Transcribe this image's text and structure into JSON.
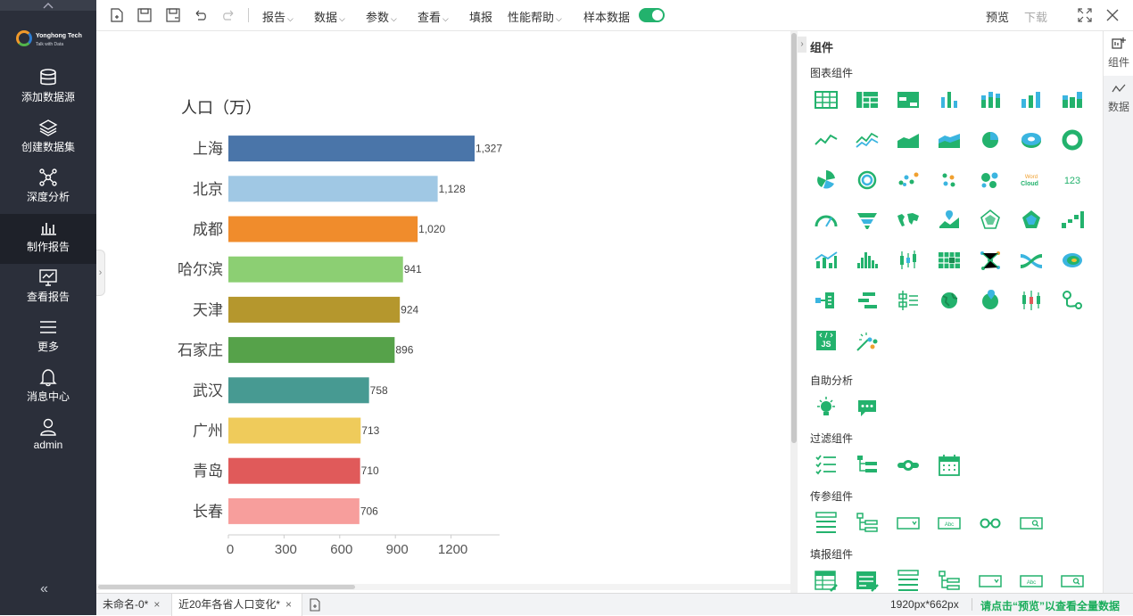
{
  "sidebar": {
    "logo": {
      "name": "Yonghong Tech",
      "tagline": "Talk with Data"
    },
    "items": [
      {
        "label": "添加数据源",
        "icon": "database-icon"
      },
      {
        "label": "创建数据集",
        "icon": "layers-icon"
      },
      {
        "label": "深度分析",
        "icon": "network-icon"
      },
      {
        "label": "制作报告",
        "icon": "bar-chart-icon",
        "active": true
      },
      {
        "label": "查看报告",
        "icon": "monitor-chart-icon"
      },
      {
        "label": "更多",
        "icon": "menu-icon"
      },
      {
        "label": "消息中心",
        "icon": "bell-icon"
      },
      {
        "label": "admin",
        "icon": "user-icon"
      }
    ],
    "collapse": "«"
  },
  "toolbar": {
    "menus": [
      "报告",
      "数据",
      "参数",
      "查看"
    ],
    "fill": "填报",
    "help": "性能帮助",
    "sample": "样本数据",
    "sample_on": true,
    "preview": "预览",
    "download": "下载"
  },
  "colors": {
    "accent": "#23b26d",
    "sidebar_bg": "#2b2f3a",
    "hint": "#1aad5b"
  },
  "chart_data": {
    "type": "bar",
    "orientation": "horizontal",
    "title": "人口（万）",
    "categories": [
      "上海",
      "北京",
      "成都",
      "哈尔滨",
      "天津",
      "石家庄",
      "武汉",
      "广州",
      "青岛",
      "长春"
    ],
    "values": [
      1327,
      1128,
      1020,
      941,
      924,
      896,
      758,
      713,
      710,
      706
    ],
    "value_labels": [
      "1,327",
      "1,128",
      "1,020",
      "941",
      "924",
      "896",
      "758",
      "713",
      "710",
      "706"
    ],
    "colors": [
      "#4a75a9",
      "#a0c8e4",
      "#f08c2c",
      "#8ccf73",
      "#b5972d",
      "#56a24a",
      "#479a92",
      "#efcb5b",
      "#e05a5a",
      "#f79e9c"
    ],
    "xticks": [
      0,
      300,
      600,
      900,
      1200
    ],
    "xlim": [
      0,
      1400
    ],
    "grid": false,
    "legend": "none"
  },
  "panel": {
    "title": "组件",
    "sections": {
      "chart": "图表组件",
      "self": "自助分析",
      "filter": "过滤组件",
      "param": "传参组件",
      "fill": "填报组件"
    },
    "wordcloud_text": "Word Cloud",
    "number_text": "123",
    "js_text": "JS",
    "abc_text": "Abc"
  },
  "rtabs": {
    "components": "组件",
    "data": "数据"
  },
  "statusbar": {
    "tabs": [
      {
        "label": "未命名-0*",
        "active": false
      },
      {
        "label": "近20年各省人口变化*",
        "active": true
      }
    ],
    "close": "×",
    "size": "1920px*662px",
    "hint": "请点击“预览”以查看全量数据"
  }
}
